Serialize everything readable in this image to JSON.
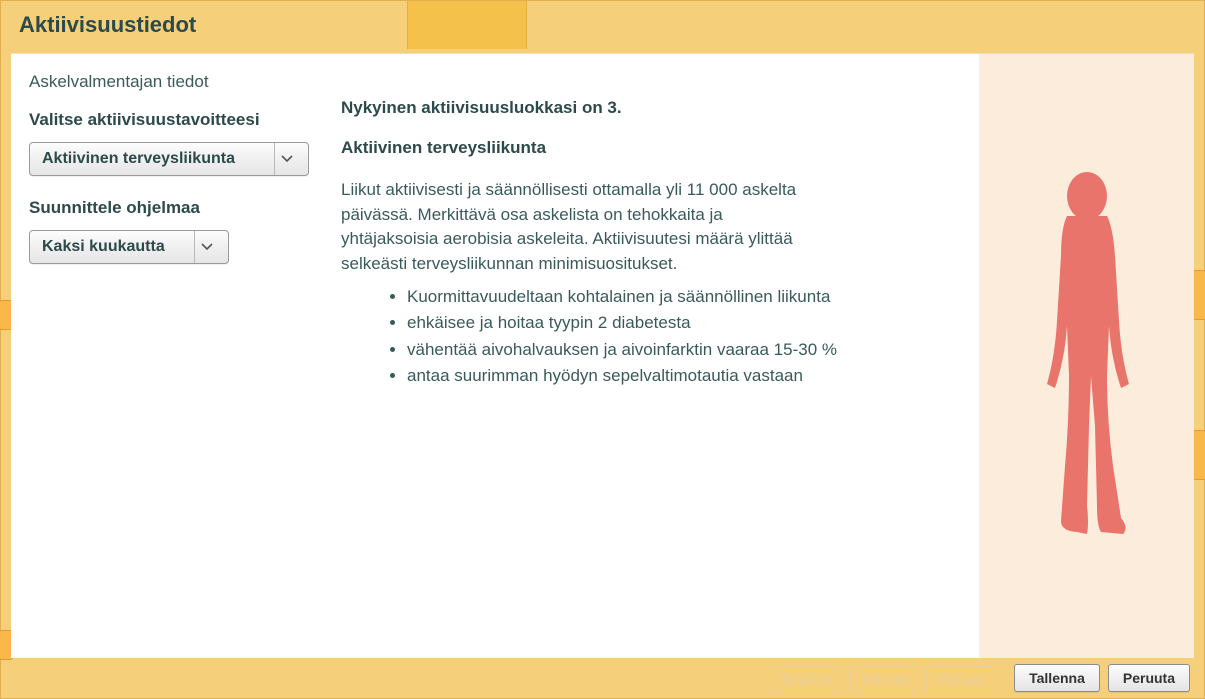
{
  "header": {
    "title": "Aktiivisuustiedot"
  },
  "left": {
    "subtitle": "Askelvalmentajan tiedot",
    "goal_label": "Valitse aktiivisuustavoitteesi",
    "goal_value": "Aktiivinen terveysliikunta",
    "plan_label": "Suunnittele ohjelmaa",
    "plan_value": "Kaksi kuukautta"
  },
  "main": {
    "current_level_text": "Nykyinen aktiivisuusluokkasi on 3.",
    "level_title": "Aktiivinen terveysliikunta",
    "body": "Liikut aktiivisesti ja säännöllisesti ottamalla yli 11 000 askelta päivässä. Merkittävä osa askelista on tehokkaita ja yhtäjaksoisia aerobisia askeleita. Aktiivisuutesi määrä ylittää selkeästi terveysliikunnan minimisuositukset.",
    "bullets": [
      "Kuormittavuudeltaan kohtalainen ja säännöllinen liikunta",
      "ehkäisee ja hoitaa tyypin 2 diabetesta",
      "vähentää aivohalvauksen ja aivoinfarktin vaaraa 15-30 %",
      "antaa suurimman hyödyn sepelvaltimotautia vastaan"
    ]
  },
  "footer": {
    "ghost": [
      "Tyhjennä",
      "Tallenna",
      "Peruuta"
    ],
    "save": "Tallenna",
    "cancel": "Peruuta"
  },
  "colors": {
    "silhouette": "#e9746c"
  }
}
